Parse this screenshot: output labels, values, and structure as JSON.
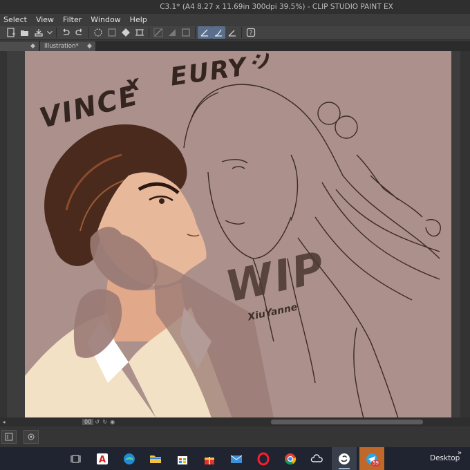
{
  "window": {
    "title": "C3.1* (A4 8.27 x 11.69in 300dpi 39.5%)  - CLIP STUDIO PAINT EX"
  },
  "menu": [
    "Select",
    "View",
    "Filter",
    "Window",
    "Help"
  ],
  "toolbar": {
    "icons": [
      "new-icon",
      "open-icon",
      "save-icon",
      "undo-icon",
      "redo-icon",
      "select-all-icon",
      "clear-icon",
      "fill-icon",
      "transform-icon",
      "snap-ruler-icon",
      "snap-grid-icon",
      "snap-special-icon",
      "pen-tool-icon",
      "brush-tool-icon",
      "ruler-tool-icon",
      "help-icon"
    ]
  },
  "tabs": [
    {
      "label": "",
      "active": false
    },
    {
      "label": "Illustration*",
      "active": true
    }
  ],
  "canvas": {
    "background": "#ab908b",
    "texts": {
      "vince": "VINCE",
      "x": "x",
      "eury": "EURY",
      "smile": ":)",
      "wip": "WIP",
      "signature": "XiuYanne"
    }
  },
  "status": {
    "zoom": "00"
  },
  "taskbar": {
    "apps": [
      "task-view-icon",
      "acrobat-icon",
      "edge-icon",
      "file-explorer-icon",
      "store-icon",
      "gift-icon",
      "mail-icon",
      "opera-icon",
      "chrome-icon",
      "onedrive-icon",
      "clip-studio-icon",
      "telegram-icon"
    ],
    "telegram_badge": "59",
    "desktop_label": "Desktop",
    "desktop_chevron": "»"
  }
}
